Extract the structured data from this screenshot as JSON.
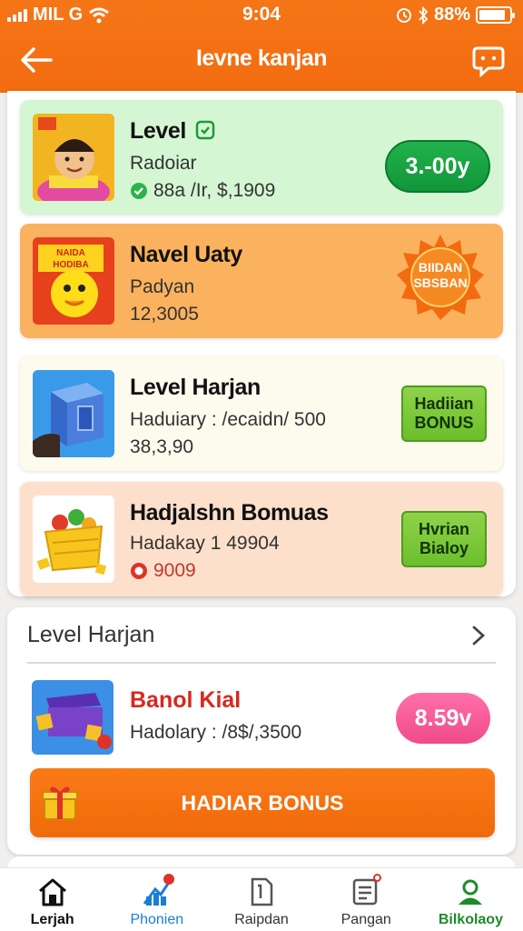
{
  "status": {
    "carrier": "MIL G",
    "time": "9:04",
    "battery": "88%",
    "battery_level": 0.88
  },
  "header": {
    "title": "Ievne kanjan"
  },
  "cards": [
    {
      "name": "Level",
      "sub": "Radoiar",
      "value": "88a /Ir, $,1909",
      "button": "3.-00y",
      "bg": "#d4f6d2"
    },
    {
      "name": "Navel Uaty",
      "sub": "Padyan",
      "value": "12,3005",
      "badge": "BIIDAN SBSBAN",
      "bg": "#fbb25e"
    },
    {
      "name": "Level Harjan",
      "sub": "Haduiary : /ecaidn/ 500",
      "value": "38,3,90",
      "button": "Hadiian BONUS",
      "bg": "#fdfaee"
    },
    {
      "name": "Hadjalshn Bomuas",
      "sub": "Hadakay 1 49904",
      "value": "9009",
      "button": "Hvrian Bialoy",
      "bg": "#fde0cb"
    }
  ],
  "section": {
    "heading": "Level Harjan",
    "item": {
      "name": "Banol Kial",
      "sub": "Hadolary : /8$/,3500",
      "button": "8.59v"
    },
    "cta": "HADIAR BONUS"
  },
  "tabs": [
    {
      "label": "Lerjah",
      "color": "#111111"
    },
    {
      "label": "Phonien",
      "color": "#1a7fd6"
    },
    {
      "label": "Raipdan",
      "color": "#333333"
    },
    {
      "label": "Pangan",
      "color": "#333333"
    },
    {
      "label": "Bilkolaoy",
      "color": "#1d8a2c"
    }
  ],
  "colors": {
    "brand": "#f36b10",
    "green": "#22b14c",
    "pink": "#f04b8b"
  }
}
